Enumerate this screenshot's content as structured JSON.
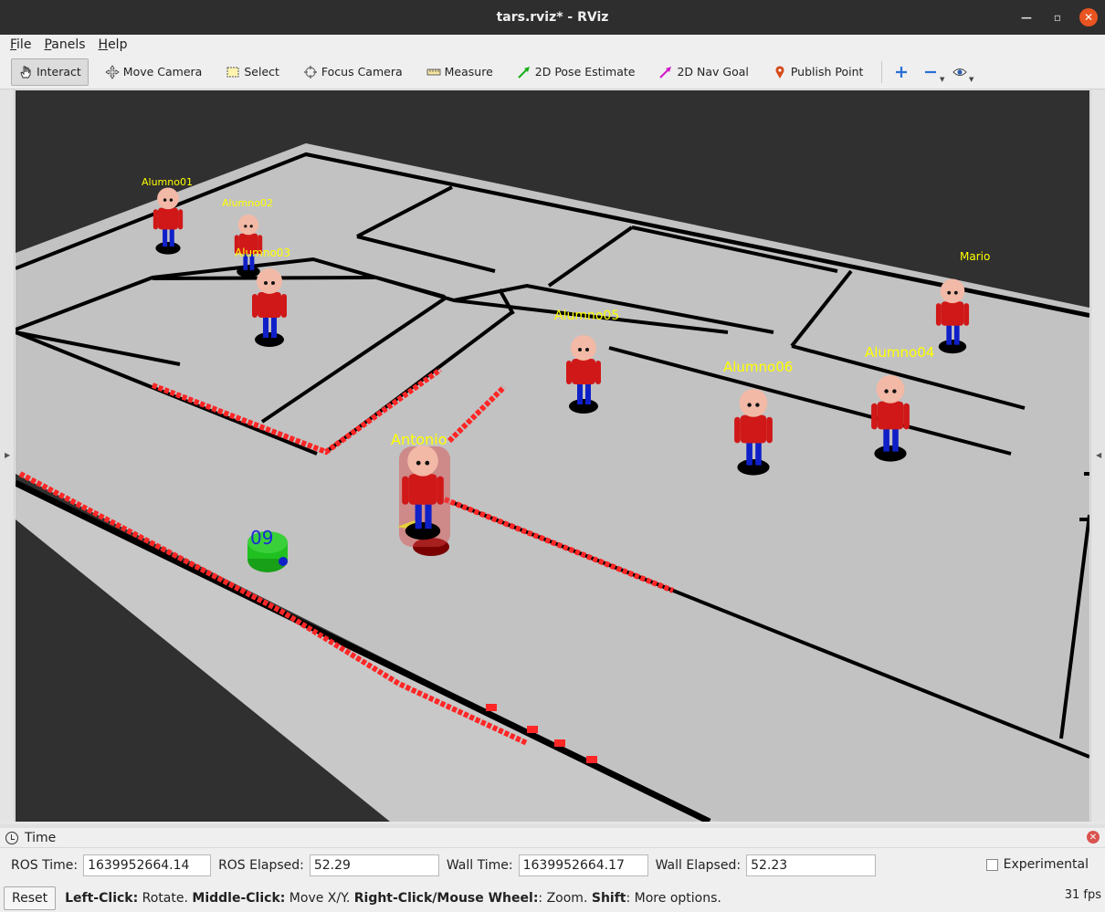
{
  "window": {
    "title": "tars.rviz* - RViz"
  },
  "menu": [
    {
      "key": "F",
      "rest": "ile"
    },
    {
      "key": "P",
      "rest": "anels"
    },
    {
      "key": "H",
      "rest": "elp"
    }
  ],
  "toolbar": {
    "interact": "Interact",
    "move_camera": "Move Camera",
    "select": "Select",
    "focus_camera": "Focus Camera",
    "measure": "Measure",
    "pose_estimate": "2D Pose Estimate",
    "nav_goal": "2D Nav Goal",
    "publish_point": "Publish Point"
  },
  "scene": {
    "people": [
      {
        "label": "Alumno01"
      },
      {
        "label": "Alumno02"
      },
      {
        "label": "Alumno03"
      },
      {
        "label": "Alumno05"
      },
      {
        "label": "Mario"
      },
      {
        "label": "Alumno06"
      },
      {
        "label": "Alumno04"
      },
      {
        "label": "Antonio"
      }
    ],
    "robot_label": "09",
    "colors": {
      "floor": "#c0c0c0",
      "background": "#303030",
      "laser": "#ff2a2a",
      "label": "#ffff00",
      "shirt": "#d01818",
      "pants": "#1020c8"
    }
  },
  "time_panel": {
    "title": "Time",
    "ros_time_label": "ROS Time:",
    "ros_time": "1639952664.14",
    "ros_elapsed_label": "ROS Elapsed:",
    "ros_elapsed": "52.29",
    "wall_time_label": "Wall Time:",
    "wall_time": "1639952664.17",
    "wall_elapsed_label": "Wall Elapsed:",
    "wall_elapsed": "52.23",
    "experimental": "Experimental"
  },
  "status": {
    "reset": "Reset",
    "h1": "Left-Click:",
    "t1": " Rotate. ",
    "h2": "Middle-Click:",
    "t2": " Move X/Y. ",
    "h3": "Right-Click/Mouse Wheel:",
    "t3": ": Zoom. ",
    "h4": "Shift",
    "t4": ": More options.",
    "fps": "31 fps"
  }
}
